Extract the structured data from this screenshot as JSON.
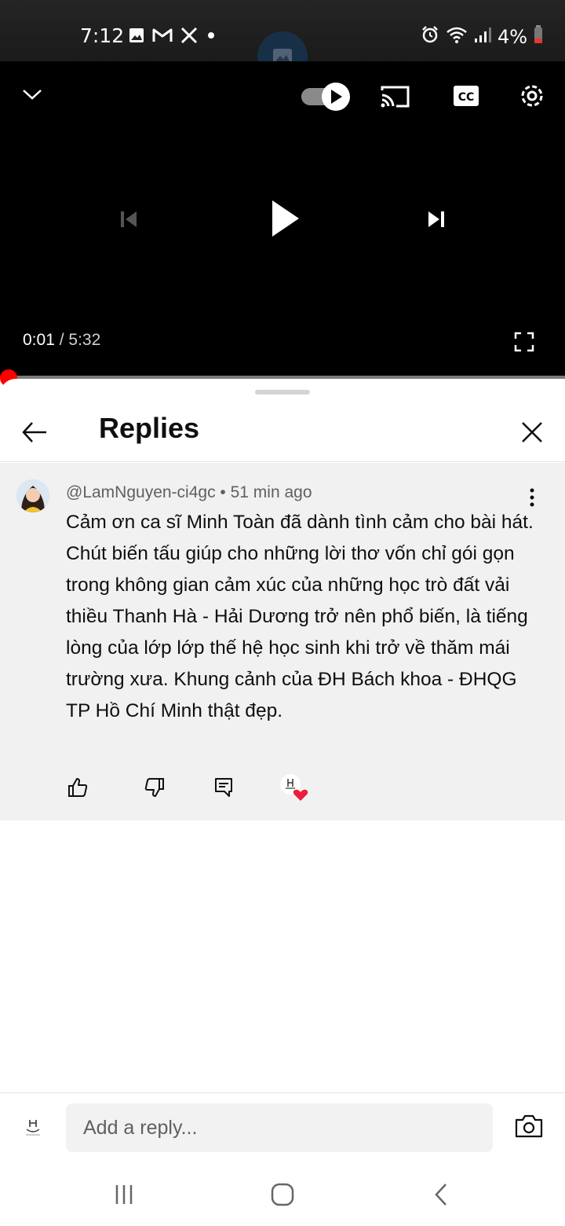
{
  "status_bar": {
    "time": "7:12",
    "battery": "4%",
    "left_icons": [
      "image-icon",
      "gmail-icon",
      "x-icon",
      "dot-icon"
    ],
    "right_icons": [
      "alarm-icon",
      "wifi-icon",
      "signal-icon",
      "battery-icon"
    ]
  },
  "player": {
    "current_time": "0:01",
    "separator": " / ",
    "duration": "5:32",
    "autoplay": true,
    "progress_fraction": 0.003,
    "progress_color": "#ff0000"
  },
  "replies_panel": {
    "title": "Replies",
    "comment": {
      "author": "@LamNguyen-ci4gc",
      "meta_separator": " • ",
      "age": "51 min ago",
      "text": "Cảm ơn ca sĩ Minh Toàn đã dành tình cảm cho bài hát. Chút biến tấu giúp cho những lời thơ vốn chỉ gói gọn trong không gian cảm xúc của những học trò đất vải thiều Thanh Hà - Hải Dương trở nên phổ biến, là tiếng lòng của lớp lớp thế hệ học sinh khi trở về thăm mái trường xưa. Khung cảnh của ĐH Bách khoa - ĐHQG TP Hồ Chí Minh thật đẹp."
    },
    "reply_input_placeholder": "Add a reply..."
  },
  "colors": {
    "accent": "#ff0000",
    "comment_bg": "#f1f1f1",
    "heart": "#ee1c3e"
  }
}
